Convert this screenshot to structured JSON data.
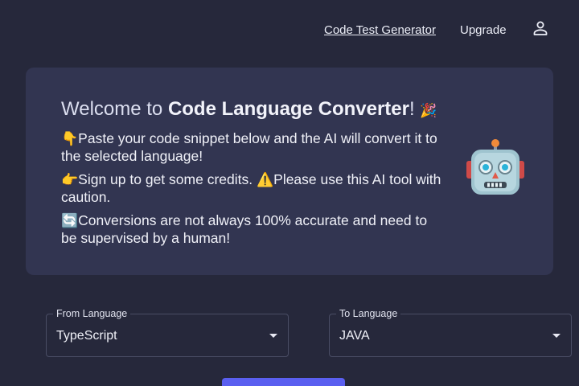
{
  "nav": {
    "generator_label": "Code Test Generator",
    "upgrade_label": "Upgrade",
    "user_icon": "user-icon"
  },
  "welcome": {
    "title_prefix": "Welcome to ",
    "title_bold": "Code Language Converter",
    "title_suffix": "!",
    "title_emoji": "🎉",
    "line1_emoji": "👇",
    "line1": "Paste your code snippet below and the AI will convert it to the selected language!",
    "line2_emoji": "👉",
    "line2a": "Sign up to get some credits. ",
    "line2_warn_emoji": "⚠️",
    "line2b": "Please use this AI tool with caution.",
    "line3_emoji": "🔄",
    "line3": "Conversions are not always 100% accurate and need to be supervised by a human!",
    "robot_icon": "robot-icon"
  },
  "form": {
    "from_label": "From Language",
    "from_value": "TypeScript",
    "to_label": "To Language",
    "to_value": "JAVA"
  },
  "colors": {
    "background": "#26283b",
    "card": "#323551",
    "accent": "#5a5ff0"
  }
}
